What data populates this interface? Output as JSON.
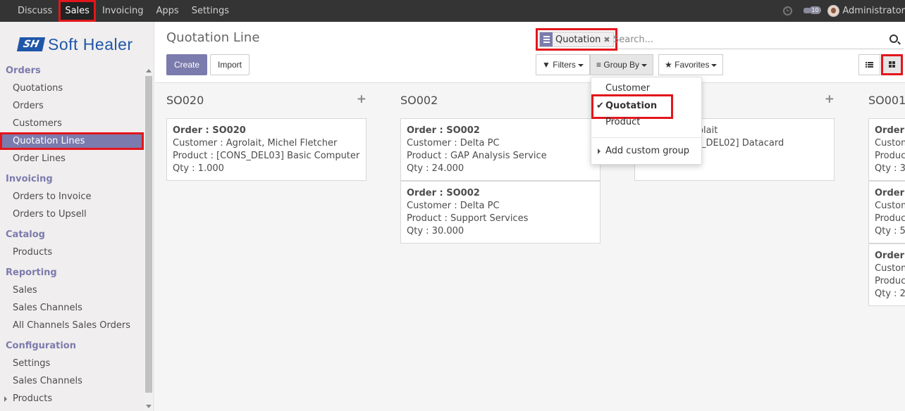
{
  "topbar": {
    "menu": [
      "Discuss",
      "Sales",
      "Invoicing",
      "Apps",
      "Settings"
    ],
    "active": "Sales",
    "chat_count": "10",
    "user_name": "Administrator"
  },
  "logo": {
    "mark": "SH",
    "text": "Soft Healer"
  },
  "sidebar": [
    {
      "section": "Orders",
      "items": [
        "Quotations",
        "Orders",
        "Customers",
        "Quotation Lines",
        "Order Lines"
      ]
    },
    {
      "section": "Invoicing",
      "items": [
        "Orders to Invoice",
        "Orders to Upsell"
      ]
    },
    {
      "section": "Catalog",
      "items": [
        "Products"
      ]
    },
    {
      "section": "Reporting",
      "items": [
        "Sales",
        "Sales Channels",
        "All Channels Sales Orders"
      ]
    },
    {
      "section": "Configuration",
      "items": [
        "Settings",
        "Sales Channels",
        "Products"
      ]
    }
  ],
  "sidebar_selected": "Quotation Lines",
  "control_panel": {
    "title": "Quotation Line",
    "create_label": "Create",
    "import_label": "Import",
    "search_facet": "Quotation",
    "search_placeholder": "Search...",
    "filters_label": "Filters",
    "groupby_label": "Group By",
    "favorites_label": "Favorites"
  },
  "groupby_menu": {
    "options": [
      "Customer",
      "Quotation",
      "Product"
    ],
    "selected": "Quotation",
    "custom_label": "Add custom group"
  },
  "kanban": {
    "columns": [
      {
        "title": "SO020",
        "cards": [
          {
            "order": "Order : SO020",
            "customer": "Customer : Agrolait, Michel Fletcher",
            "product": "Product : [CONS_DEL03] Basic Computer",
            "qty": "Qty : 1.000"
          }
        ]
      },
      {
        "title": "SO002",
        "cards": [
          {
            "order": "Order : SO002",
            "customer": "Customer : Delta PC",
            "product": "Product : GAP Analysis Service",
            "qty": "Qty : 24.000"
          },
          {
            "order": "Order : SO002",
            "customer": "Customer : Delta PC",
            "product": "Product : Support Services",
            "qty": "Qty : 30.000"
          }
        ]
      },
      {
        "title": "",
        "cards": [
          {
            "order": "",
            "customer": "rolait",
            "product": "D_DEL02] Datacard",
            "qty": "Qty : 2.000"
          }
        ]
      },
      {
        "title": "SO001",
        "cards": [
          {
            "order": "Order : ",
            "customer": "Custom",
            "product": "Product",
            "qty": "Qty : 3.0"
          },
          {
            "order": "Order : ",
            "customer": "Custom",
            "product": "Product",
            "qty": "Qty : 5.0"
          },
          {
            "order": "Order : ",
            "customer": "Custom",
            "product": "Product",
            "qty": "Qty : 2.0"
          }
        ]
      }
    ]
  },
  "colors": {
    "topbar": "#343434",
    "accent": "#7c7bad",
    "highlight": "#e3161b",
    "logo": "#1f56a8"
  }
}
